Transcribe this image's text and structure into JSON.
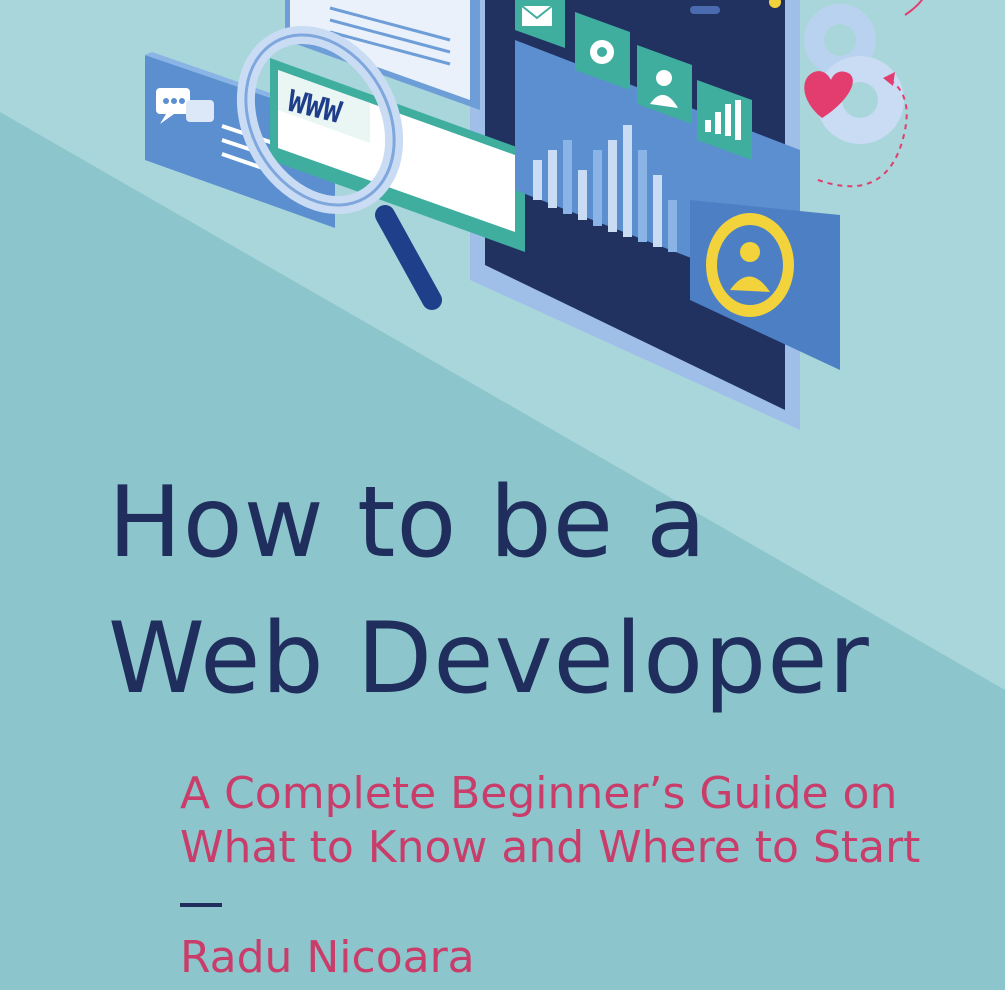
{
  "cover": {
    "title_line1": "How to be a",
    "title_line2": "Web Developer",
    "subtitle_line1": "A Complete Beginner’s Guide on",
    "subtitle_line2": "What to Know and Where to Start",
    "separator": "—",
    "author": "Radu Nicoara"
  },
  "illustration": {
    "magnifier_text": "WWW",
    "icons": [
      "chat-icon",
      "mail-icon",
      "gear-icon",
      "user-icon",
      "bar-chart-icon",
      "heart-icon",
      "user-badge-icon"
    ]
  },
  "colors": {
    "background_dark": "#8cc6cc",
    "background_light": "#a9d6da",
    "title": "#1f2e5c",
    "subtitle": "#c93d6a",
    "accent_yellow": "#f2d33b",
    "panel_blue": "#5b8fd0",
    "screen_navy": "#213261",
    "tile_teal": "#3fae9f"
  }
}
